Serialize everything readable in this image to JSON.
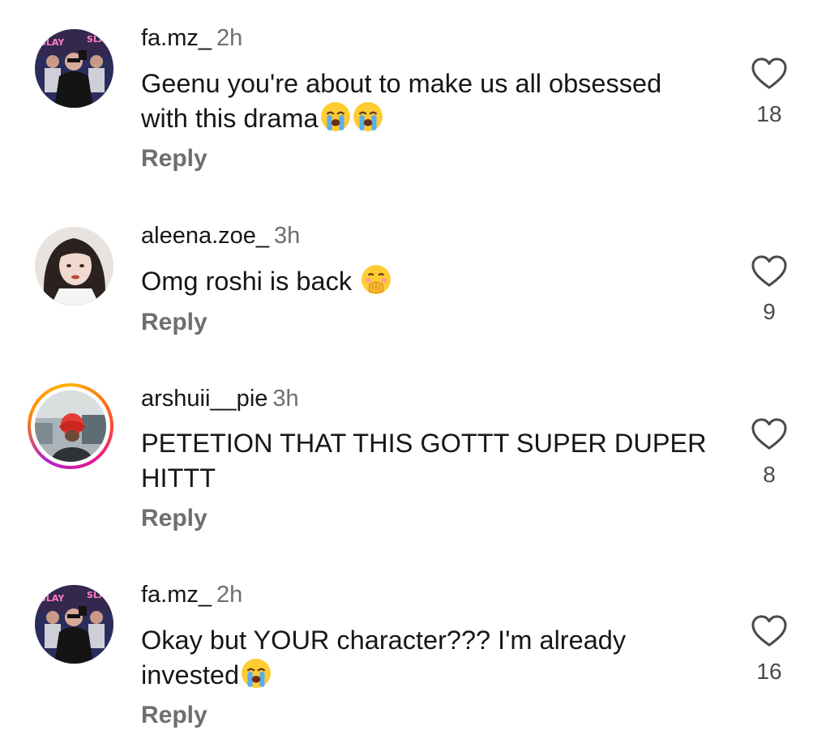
{
  "comments": [
    {
      "username": "fa.mz_",
      "time": "2h",
      "text": "Geenu you're about to make us all obsessed with this drama",
      "emojis": [
        "loudly-crying-face-icon",
        "loudly-crying-face-icon"
      ],
      "reply_label": "Reply",
      "likes": "18"
    },
    {
      "username": "aleena.zoe_",
      "time": "3h",
      "text": "Omg roshi is back ",
      "emojis": [
        "face-with-hand-over-mouth-icon"
      ],
      "reply_label": "Reply",
      "likes": "9"
    },
    {
      "username": "arshuii__pie",
      "time": "3h",
      "text": "PETETION THAT THIS GOTTT SUPER DUPER HITTT",
      "emojis": [],
      "reply_label": "Reply",
      "likes": "8"
    },
    {
      "username": "fa.mz_",
      "time": "2h",
      "text": "Okay but YOUR character??? I'm already invested",
      "emojis": [
        "loudly-crying-face-icon"
      ],
      "reply_label": "Reply",
      "likes": "16"
    }
  ],
  "avatar_text": {
    "slay": "SLAY"
  },
  "colors": {
    "text_primary": "#161616",
    "text_secondary": "#6e6e73",
    "heart_outline": "#4a4a4e",
    "story_ring": "#e8178a"
  }
}
